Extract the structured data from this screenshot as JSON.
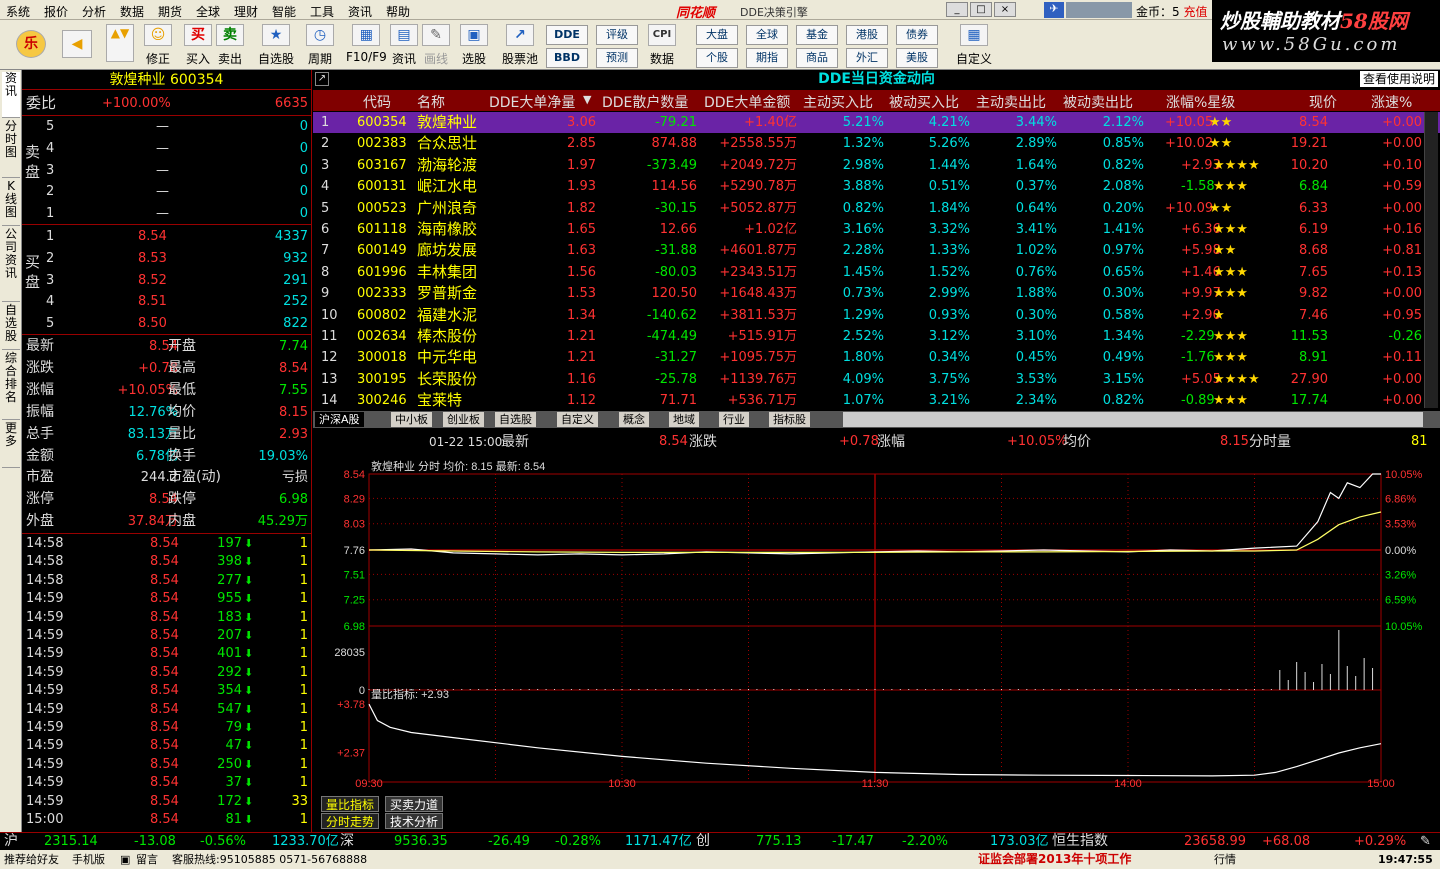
{
  "menu": [
    "系统",
    "报价",
    "分析",
    "数据",
    "期货",
    "全球",
    "理财",
    "智能",
    "工具",
    "资讯",
    "帮助"
  ],
  "app": {
    "logo": "同花顺",
    "title": "DDE决策引擎",
    "coin_label": "金币：5",
    "recharge": "充值"
  },
  "watermark": {
    "line1a": "炒股輔助教材",
    "line1b": "58股网",
    "line2": "www.58Gu.com"
  },
  "toolbar": {
    "buttons": [
      {
        "icon": "乐",
        "label": ""
      },
      {
        "icon": "◀",
        "label": ""
      },
      {
        "icon": "▲▼",
        "label": ""
      },
      {
        "icon": "☺",
        "label": "修正"
      },
      {
        "icon": "买",
        "label": "买入"
      },
      {
        "icon": "卖",
        "label": "卖出"
      },
      {
        "icon": "★",
        "label": "自选股"
      },
      {
        "icon": "◷",
        "label": "周期"
      },
      {
        "icon": "▦",
        "label": "F10/F9"
      },
      {
        "icon": "▤",
        "label": "资讯"
      },
      {
        "icon": "✎",
        "label": "画线"
      },
      {
        "icon": "▣",
        "label": "选股"
      },
      {
        "icon": "↗",
        "label": "股票池"
      },
      {
        "icon": "CPI",
        "label": "数据"
      },
      {
        "icon": "▦",
        "label": "自定义"
      }
    ],
    "small": [
      "DDE",
      "BBD",
      "评级",
      "预测",
      "大盘",
      "个股",
      "全球",
      "期指",
      "基金",
      "商品",
      "港股",
      "外汇",
      "债券",
      "美股"
    ]
  },
  "left_tabs": [
    "资讯",
    "分时图",
    "K线图",
    "公司资讯",
    "自选股",
    "综合排名",
    "更多"
  ],
  "quote": {
    "stock": "敦煌种业 600354",
    "weibi_label": "委比",
    "weibi_pct": "+100.00%",
    "weibi_val": "6635",
    "sell_label": "卖盘",
    "buy_label": "买盘",
    "sell": [
      {
        "n": "5",
        "p": "—",
        "v": "0"
      },
      {
        "n": "4",
        "p": "—",
        "v": "0"
      },
      {
        "n": "3",
        "p": "—",
        "v": "0"
      },
      {
        "n": "2",
        "p": "—",
        "v": "0"
      },
      {
        "n": "1",
        "p": "—",
        "v": "0"
      }
    ],
    "buy": [
      {
        "n": "1",
        "p": "8.54",
        "v": "4337"
      },
      {
        "n": "2",
        "p": "8.53",
        "v": "932"
      },
      {
        "n": "3",
        "p": "8.52",
        "v": "291"
      },
      {
        "n": "4",
        "p": "8.51",
        "v": "252"
      },
      {
        "n": "5",
        "p": "8.50",
        "v": "822"
      }
    ],
    "stats": [
      {
        "l1": "最新",
        "v1": "8.54",
        "l2": "开盘",
        "v2": "7.74",
        "c1": "red",
        "c2": "grn"
      },
      {
        "l1": "涨跌",
        "v1": "+0.78",
        "l2": "最高",
        "v2": "8.54",
        "c1": "red",
        "c2": "red"
      },
      {
        "l1": "涨幅",
        "v1": "+10.05%",
        "l2": "最低",
        "v2": "7.55",
        "c1": "red",
        "c2": "grn"
      },
      {
        "l1": "振幅",
        "v1": "12.76%",
        "l2": "均价",
        "v2": "8.15",
        "c1": "cyn",
        "c2": "red"
      },
      {
        "l1": "总手",
        "v1": "83.13万",
        "l2": "量比",
        "v2": "2.93",
        "c1": "cyn",
        "c2": "red"
      },
      {
        "l1": "金额",
        "v1": "6.78亿",
        "l2": "换手",
        "v2": "19.03%",
        "c1": "cyn",
        "c2": "cyn"
      },
      {
        "l1": "市盈",
        "v1": "244.2",
        "l2": "市盈(动)",
        "v2": "亏损",
        "c1": "wht",
        "c2": "wht"
      },
      {
        "l1": "涨停",
        "v1": "8.54",
        "l2": "跌停",
        "v2": "6.98",
        "c1": "red",
        "c2": "grn"
      },
      {
        "l1": "外盘",
        "v1": "37.84万",
        "l2": "内盘",
        "v2": "45.29万",
        "c1": "red",
        "c2": "grn"
      }
    ],
    "ticks": [
      {
        "t": "14:58",
        "p": "8.54",
        "v": "197",
        "n": "1"
      },
      {
        "t": "14:58",
        "p": "8.54",
        "v": "398",
        "n": "1"
      },
      {
        "t": "14:58",
        "p": "8.54",
        "v": "277",
        "n": "1"
      },
      {
        "t": "14:59",
        "p": "8.54",
        "v": "955",
        "n": "1"
      },
      {
        "t": "14:59",
        "p": "8.54",
        "v": "183",
        "n": "1"
      },
      {
        "t": "14:59",
        "p": "8.54",
        "v": "207",
        "n": "1"
      },
      {
        "t": "14:59",
        "p": "8.54",
        "v": "401",
        "n": "1"
      },
      {
        "t": "14:59",
        "p": "8.54",
        "v": "292",
        "n": "1"
      },
      {
        "t": "14:59",
        "p": "8.54",
        "v": "354",
        "n": "1"
      },
      {
        "t": "14:59",
        "p": "8.54",
        "v": "547",
        "n": "1"
      },
      {
        "t": "14:59",
        "p": "8.54",
        "v": "79",
        "n": "1"
      },
      {
        "t": "14:59",
        "p": "8.54",
        "v": "47",
        "n": "1"
      },
      {
        "t": "14:59",
        "p": "8.54",
        "v": "250",
        "n": "1"
      },
      {
        "t": "14:59",
        "p": "8.54",
        "v": "37",
        "n": "1"
      },
      {
        "t": "14:59",
        "p": "8.54",
        "v": "172",
        "n": "33"
      },
      {
        "t": "15:00",
        "p": "8.54",
        "v": "81",
        "n": "1"
      }
    ]
  },
  "dde": {
    "title": "DDE当日资金动向",
    "help": "查看使用说明",
    "headers": [
      "代码",
      "名称",
      "DDE大单净量",
      "DDE散户数量",
      "DDE大单金额",
      "主动买入比",
      "被动买入比",
      "主动卖出比",
      "被动卖出比",
      "涨幅%星级",
      "现价",
      "涨速%"
    ],
    "rows": [
      {
        "i": "1",
        "c": "600354",
        "n": "敦煌种业",
        "a": "3.06",
        "b": "-79.21",
        "m": "+1.40亿",
        "zb": "5.21%",
        "bb": "4.21%",
        "zs": "3.44%",
        "bs": "2.12%",
        "z": "+10.05",
        "s": "★★",
        "p": "8.54",
        "sp": "+0.00"
      },
      {
        "i": "2",
        "c": "002383",
        "n": "合众思壮",
        "a": "2.85",
        "b": "874.88",
        "m": "+2558.55万",
        "zb": "1.32%",
        "bb": "5.26%",
        "zs": "2.89%",
        "bs": "0.85%",
        "z": "+10.02",
        "s": "★★",
        "p": "19.21",
        "sp": "+0.00"
      },
      {
        "i": "3",
        "c": "603167",
        "n": "渤海轮渡",
        "a": "1.97",
        "b": "-373.49",
        "m": "+2049.72万",
        "zb": "2.98%",
        "bb": "1.44%",
        "zs": "1.64%",
        "bs": "0.82%",
        "z": "+2.93",
        "s": "★★★★",
        "p": "10.20",
        "sp": "+0.10"
      },
      {
        "i": "4",
        "c": "600131",
        "n": "岷江水电",
        "a": "1.93",
        "b": "114.56",
        "m": "+5290.78万",
        "zb": "3.88%",
        "bb": "0.51%",
        "zs": "0.37%",
        "bs": "2.08%",
        "z": "-1.58",
        "s": "★★★",
        "p": "6.84",
        "sp": "+0.59"
      },
      {
        "i": "5",
        "c": "000523",
        "n": "广州浪奇",
        "a": "1.82",
        "b": "-30.15",
        "m": "+5052.87万",
        "zb": "0.82%",
        "bb": "1.84%",
        "zs": "0.64%",
        "bs": "0.20%",
        "z": "+10.09",
        "s": "★★",
        "p": "6.33",
        "sp": "+0.00"
      },
      {
        "i": "6",
        "c": "601118",
        "n": "海南橡胶",
        "a": "1.65",
        "b": "12.66",
        "m": "+1.02亿",
        "zb": "3.16%",
        "bb": "3.32%",
        "zs": "3.41%",
        "bs": "1.41%",
        "z": "+6.36",
        "s": "★★★",
        "p": "6.19",
        "sp": "+0.16"
      },
      {
        "i": "7",
        "c": "600149",
        "n": "廊坊发展",
        "a": "1.63",
        "b": "-31.88",
        "m": "+4601.87万",
        "zb": "2.28%",
        "bb": "1.33%",
        "zs": "1.02%",
        "bs": "0.97%",
        "z": "+5.98",
        "s": "★★",
        "p": "8.68",
        "sp": "+0.81"
      },
      {
        "i": "8",
        "c": "601996",
        "n": "丰林集团",
        "a": "1.56",
        "b": "-80.03",
        "m": "+2343.51万",
        "zb": "1.45%",
        "bb": "1.52%",
        "zs": "0.76%",
        "bs": "0.65%",
        "z": "+1.46",
        "s": "★★★",
        "p": "7.65",
        "sp": "+0.13"
      },
      {
        "i": "9",
        "c": "002333",
        "n": "罗普斯金",
        "a": "1.53",
        "b": "120.50",
        "m": "+1648.43万",
        "zb": "0.73%",
        "bb": "2.99%",
        "zs": "1.88%",
        "bs": "0.30%",
        "z": "+9.97",
        "s": "★★★",
        "p": "9.82",
        "sp": "+0.00"
      },
      {
        "i": "10",
        "c": "600802",
        "n": "福建水泥",
        "a": "1.34",
        "b": "-140.62",
        "m": "+3811.53万",
        "zb": "1.29%",
        "bb": "0.93%",
        "zs": "0.30%",
        "bs": "0.58%",
        "z": "+2.90",
        "s": "★",
        "p": "7.46",
        "sp": "+0.95"
      },
      {
        "i": "11",
        "c": "002634",
        "n": "棒杰股份",
        "a": "1.21",
        "b": "-474.49",
        "m": "+515.91万",
        "zb": "2.52%",
        "bb": "3.12%",
        "zs": "3.10%",
        "bs": "1.34%",
        "z": "-2.29",
        "s": "★★★",
        "p": "11.53",
        "sp": "-0.26"
      },
      {
        "i": "12",
        "c": "300018",
        "n": "中元华电",
        "a": "1.21",
        "b": "-31.27",
        "m": "+1095.75万",
        "zb": "1.80%",
        "bb": "0.34%",
        "zs": "0.45%",
        "bs": "0.49%",
        "z": "-1.76",
        "s": "★★★",
        "p": "8.91",
        "sp": "+0.11"
      },
      {
        "i": "13",
        "c": "300195",
        "n": "长荣股份",
        "a": "1.16",
        "b": "-25.78",
        "m": "+1139.76万",
        "zb": "4.09%",
        "bb": "3.75%",
        "zs": "3.53%",
        "bs": "3.15%",
        "z": "+5.05",
        "s": "★★★★",
        "p": "27.90",
        "sp": "+0.00"
      },
      {
        "i": "14",
        "c": "300246",
        "n": "宝莱特",
        "a": "1.12",
        "b": "71.71",
        "m": "+536.71万",
        "zb": "1.07%",
        "bb": "3.21%",
        "zs": "2.34%",
        "bs": "0.82%",
        "z": "-0.89",
        "s": "★★★",
        "p": "17.74",
        "sp": "+0.00"
      }
    ]
  },
  "bottom_tabs": [
    "沪深A股",
    "中小板",
    "创业板",
    "自选股",
    "自定义",
    "概念",
    "地域",
    "行业",
    "指标股"
  ],
  "info": {
    "date": "01-22 15:00",
    "l1": "最新",
    "v1": "8.54",
    "l2": "涨跌",
    "v2": "+0.78",
    "l3": "涨幅",
    "v3": "+10.05%",
    "l4": "均价",
    "v4": "8.15",
    "l5": "分时量",
    "v5": "81"
  },
  "chart_data": {
    "type": "line",
    "title": "敦煌种业 分时 均价: 8.15 最新: 8.54",
    "price_ticks": [
      "8.54",
      "8.29",
      "8.03",
      "7.76",
      "7.51",
      "7.25",
      "6.98"
    ],
    "pct_ticks": [
      "10.05%",
      "6.86%",
      "3.53%",
      "0.00%",
      "3.26%",
      "6.59%",
      "10.05%"
    ],
    "ylim": [
      6.98,
      8.54
    ],
    "prev_close": 7.76,
    "x_ticks": [
      "09:30",
      "10:30",
      "11:30",
      "14:00",
      "15:00"
    ],
    "vol_tick": "28035",
    "vol_zero": "0",
    "series": [
      {
        "name": "价格",
        "x": [
          0,
          10,
          20,
          30,
          40,
          50,
          60,
          70,
          80,
          90,
          100,
          110,
          120,
          130,
          140,
          150,
          160,
          170,
          180,
          190,
          200,
          210,
          220,
          225,
          228,
          230,
          232,
          235,
          238,
          240
        ],
        "values": [
          7.76,
          7.77,
          7.73,
          7.72,
          7.71,
          7.72,
          7.71,
          7.72,
          7.74,
          7.73,
          7.72,
          7.73,
          7.74,
          7.75,
          7.74,
          7.75,
          7.76,
          7.75,
          7.74,
          7.76,
          7.75,
          7.78,
          7.8,
          8.05,
          8.35,
          8.29,
          8.45,
          8.4,
          8.54,
          8.54
        ]
      },
      {
        "name": "均价",
        "x": [
          0,
          20,
          40,
          60,
          80,
          100,
          120,
          140,
          160,
          180,
          200,
          210,
          220,
          225,
          230,
          235,
          240
        ],
        "values": [
          7.76,
          7.75,
          7.74,
          7.735,
          7.735,
          7.735,
          7.735,
          7.74,
          7.74,
          7.745,
          7.75,
          7.75,
          7.76,
          7.87,
          8.02,
          8.1,
          8.15
        ]
      }
    ],
    "liangbi": {
      "label": "量比指标: +2.93",
      "ticks": [
        "+3.78",
        "+2.37"
      ],
      "ylim": [
        1.5,
        3.9
      ],
      "x": [
        0,
        2,
        5,
        10,
        20,
        40,
        60,
        80,
        100,
        120,
        140,
        160,
        180,
        200,
        210,
        215,
        220,
        225,
        230,
        235,
        240
      ],
      "values": [
        3.78,
        3.3,
        3.1,
        2.95,
        2.8,
        2.5,
        2.25,
        2.05,
        1.9,
        1.78,
        1.72,
        1.7,
        1.69,
        1.68,
        1.7,
        1.78,
        1.95,
        2.15,
        2.35,
        2.5,
        2.62
      ]
    }
  },
  "chart_tabs": [
    {
      "label": "量比指标",
      "act": true
    },
    {
      "label": "买卖力道",
      "act": false
    },
    {
      "label": "分时走势",
      "act": true
    },
    {
      "label": "技术分析",
      "act": false
    }
  ],
  "status": {
    "sh_label": "沪",
    "sh": "2315.14",
    "sh_chg": "-13.08",
    "sh_pct": "-0.56%",
    "sh_amt": "1233.70亿",
    "sz_label": "深",
    "sz": "9536.35",
    "sz_chg": "-26.49",
    "sz_pct": "-0.28%",
    "sz_amt": "1171.47亿",
    "cy_label": "创",
    "cy": "775.13",
    "cy_chg": "-17.47",
    "cy_pct": "-2.20%",
    "cy_amt": "173.03亿",
    "hs_label": "恒生指数",
    "hs": "23658.99",
    "hs_chg": "+68.08",
    "hs_pct": "+0.29%"
  },
  "status2": {
    "a": "推荐给好友",
    "b": "手机版",
    "c": "留言",
    "d": "客服热线:95105885 0571-56768888",
    "e": "证监会部署2013年十项工作",
    "f": "行情",
    "time": "19:47:55"
  }
}
